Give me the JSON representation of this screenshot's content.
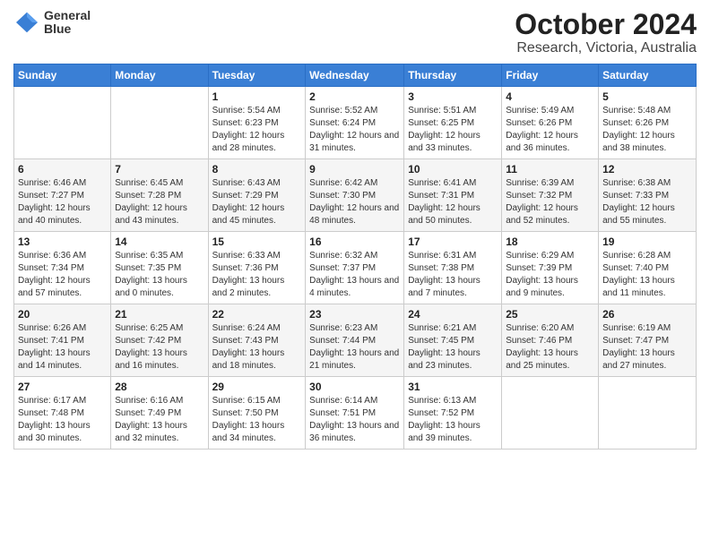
{
  "logo": {
    "line1": "General",
    "line2": "Blue"
  },
  "title": "October 2024",
  "subtitle": "Research, Victoria, Australia",
  "weekdays": [
    "Sunday",
    "Monday",
    "Tuesday",
    "Wednesday",
    "Thursday",
    "Friday",
    "Saturday"
  ],
  "weeks": [
    [
      {
        "day": "",
        "info": ""
      },
      {
        "day": "",
        "info": ""
      },
      {
        "day": "1",
        "info": "Sunrise: 5:54 AM\nSunset: 6:23 PM\nDaylight: 12 hours and 28 minutes."
      },
      {
        "day": "2",
        "info": "Sunrise: 5:52 AM\nSunset: 6:24 PM\nDaylight: 12 hours and 31 minutes."
      },
      {
        "day": "3",
        "info": "Sunrise: 5:51 AM\nSunset: 6:25 PM\nDaylight: 12 hours and 33 minutes."
      },
      {
        "day": "4",
        "info": "Sunrise: 5:49 AM\nSunset: 6:26 PM\nDaylight: 12 hours and 36 minutes."
      },
      {
        "day": "5",
        "info": "Sunrise: 5:48 AM\nSunset: 6:26 PM\nDaylight: 12 hours and 38 minutes."
      }
    ],
    [
      {
        "day": "6",
        "info": "Sunrise: 6:46 AM\nSunset: 7:27 PM\nDaylight: 12 hours and 40 minutes."
      },
      {
        "day": "7",
        "info": "Sunrise: 6:45 AM\nSunset: 7:28 PM\nDaylight: 12 hours and 43 minutes."
      },
      {
        "day": "8",
        "info": "Sunrise: 6:43 AM\nSunset: 7:29 PM\nDaylight: 12 hours and 45 minutes."
      },
      {
        "day": "9",
        "info": "Sunrise: 6:42 AM\nSunset: 7:30 PM\nDaylight: 12 hours and 48 minutes."
      },
      {
        "day": "10",
        "info": "Sunrise: 6:41 AM\nSunset: 7:31 PM\nDaylight: 12 hours and 50 minutes."
      },
      {
        "day": "11",
        "info": "Sunrise: 6:39 AM\nSunset: 7:32 PM\nDaylight: 12 hours and 52 minutes."
      },
      {
        "day": "12",
        "info": "Sunrise: 6:38 AM\nSunset: 7:33 PM\nDaylight: 12 hours and 55 minutes."
      }
    ],
    [
      {
        "day": "13",
        "info": "Sunrise: 6:36 AM\nSunset: 7:34 PM\nDaylight: 12 hours and 57 minutes."
      },
      {
        "day": "14",
        "info": "Sunrise: 6:35 AM\nSunset: 7:35 PM\nDaylight: 13 hours and 0 minutes."
      },
      {
        "day": "15",
        "info": "Sunrise: 6:33 AM\nSunset: 7:36 PM\nDaylight: 13 hours and 2 minutes."
      },
      {
        "day": "16",
        "info": "Sunrise: 6:32 AM\nSunset: 7:37 PM\nDaylight: 13 hours and 4 minutes."
      },
      {
        "day": "17",
        "info": "Sunrise: 6:31 AM\nSunset: 7:38 PM\nDaylight: 13 hours and 7 minutes."
      },
      {
        "day": "18",
        "info": "Sunrise: 6:29 AM\nSunset: 7:39 PM\nDaylight: 13 hours and 9 minutes."
      },
      {
        "day": "19",
        "info": "Sunrise: 6:28 AM\nSunset: 7:40 PM\nDaylight: 13 hours and 11 minutes."
      }
    ],
    [
      {
        "day": "20",
        "info": "Sunrise: 6:26 AM\nSunset: 7:41 PM\nDaylight: 13 hours and 14 minutes."
      },
      {
        "day": "21",
        "info": "Sunrise: 6:25 AM\nSunset: 7:42 PM\nDaylight: 13 hours and 16 minutes."
      },
      {
        "day": "22",
        "info": "Sunrise: 6:24 AM\nSunset: 7:43 PM\nDaylight: 13 hours and 18 minutes."
      },
      {
        "day": "23",
        "info": "Sunrise: 6:23 AM\nSunset: 7:44 PM\nDaylight: 13 hours and 21 minutes."
      },
      {
        "day": "24",
        "info": "Sunrise: 6:21 AM\nSunset: 7:45 PM\nDaylight: 13 hours and 23 minutes."
      },
      {
        "day": "25",
        "info": "Sunrise: 6:20 AM\nSunset: 7:46 PM\nDaylight: 13 hours and 25 minutes."
      },
      {
        "day": "26",
        "info": "Sunrise: 6:19 AM\nSunset: 7:47 PM\nDaylight: 13 hours and 27 minutes."
      }
    ],
    [
      {
        "day": "27",
        "info": "Sunrise: 6:17 AM\nSunset: 7:48 PM\nDaylight: 13 hours and 30 minutes."
      },
      {
        "day": "28",
        "info": "Sunrise: 6:16 AM\nSunset: 7:49 PM\nDaylight: 13 hours and 32 minutes."
      },
      {
        "day": "29",
        "info": "Sunrise: 6:15 AM\nSunset: 7:50 PM\nDaylight: 13 hours and 34 minutes."
      },
      {
        "day": "30",
        "info": "Sunrise: 6:14 AM\nSunset: 7:51 PM\nDaylight: 13 hours and 36 minutes."
      },
      {
        "day": "31",
        "info": "Sunrise: 6:13 AM\nSunset: 7:52 PM\nDaylight: 13 hours and 39 minutes."
      },
      {
        "day": "",
        "info": ""
      },
      {
        "day": "",
        "info": ""
      }
    ]
  ]
}
